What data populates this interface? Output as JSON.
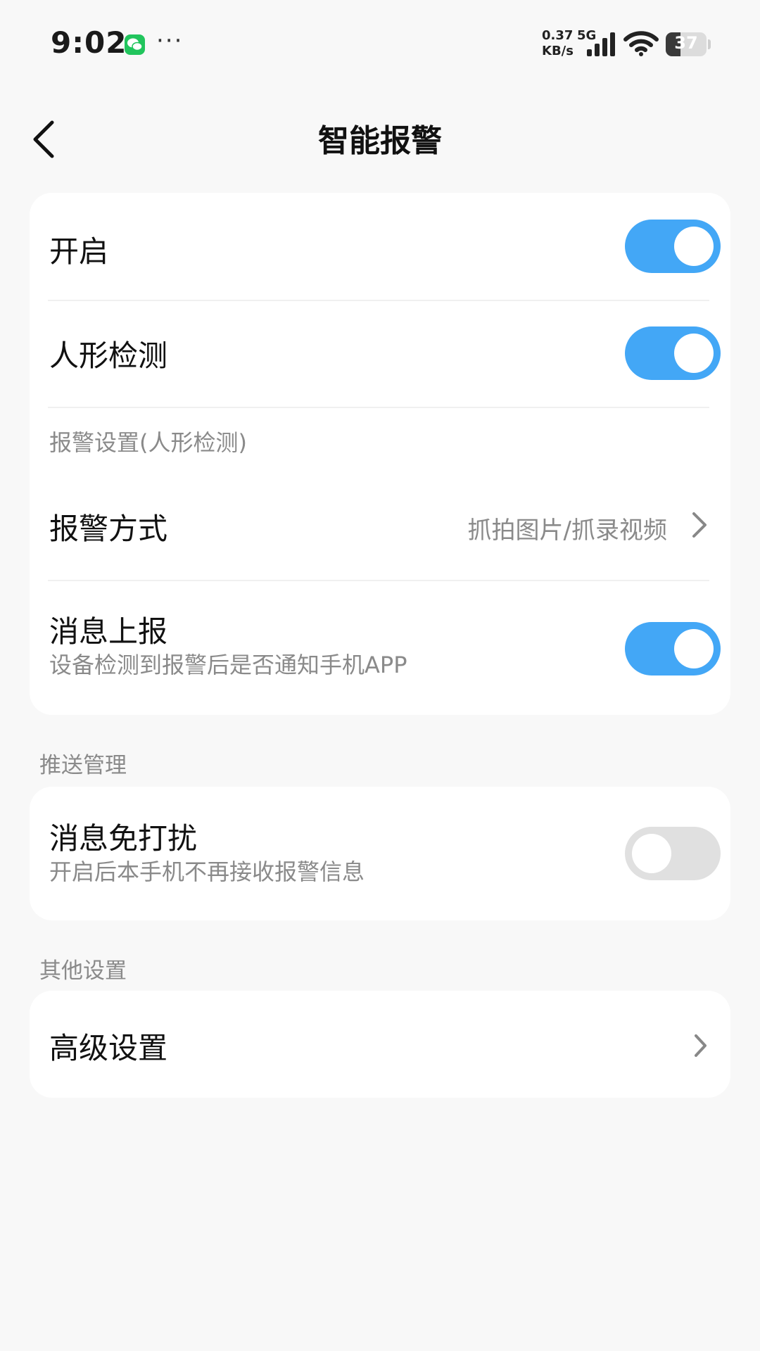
{
  "status_bar": {
    "time": "9:02",
    "more": "···",
    "net_speed_value": "0.37",
    "net_speed_unit": "KB/s",
    "network_type": "5G",
    "battery_level": 37,
    "battery_text": "37",
    "icons": [
      "wechat-icon",
      "signal-icon",
      "wifi-icon",
      "battery-icon"
    ]
  },
  "header": {
    "title": "智能报警",
    "back_icon": "chevron-left-icon"
  },
  "main_card": {
    "enable": {
      "label": "开启",
      "on": true
    },
    "human_detection": {
      "label": "人形检测",
      "on": true
    },
    "alarm_settings_label": "报警设置(人形检测)",
    "alarm_mode": {
      "label": "报警方式",
      "value": "抓拍图片/抓录视频"
    },
    "message_report": {
      "label": "消息上报",
      "description": "设备检测到报警后是否通知手机APP",
      "on": true
    }
  },
  "push_section": {
    "title": "推送管理",
    "do_not_disturb": {
      "label": "消息免打扰",
      "description": "开启后本手机不再接收报警信息",
      "on": false
    }
  },
  "other_section": {
    "title": "其他设置",
    "advanced": {
      "label": "高级设置"
    }
  },
  "colors": {
    "accent": "#43a7f6",
    "toggle_off": "#e0e0e0",
    "background": "#f8f8f8",
    "card": "#ffffff",
    "secondary_text": "#8a8a8a"
  }
}
